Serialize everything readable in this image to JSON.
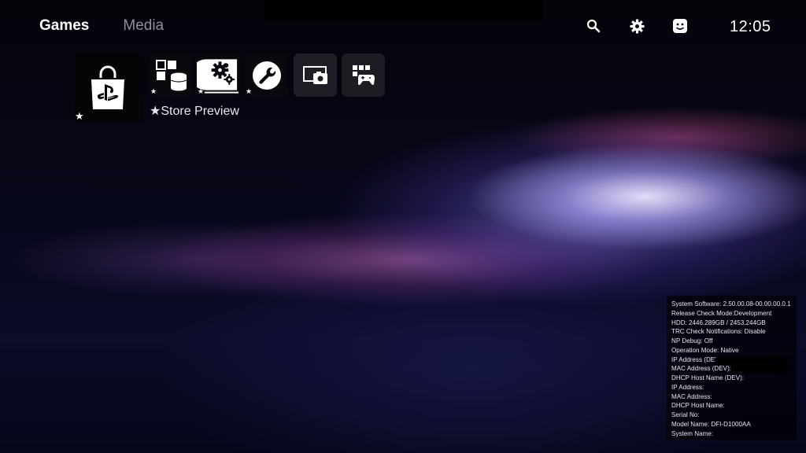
{
  "nav": {
    "tabs": [
      {
        "label": "Games",
        "active": true
      },
      {
        "label": "Media",
        "active": false
      }
    ]
  },
  "topbar": {
    "icons": [
      "search-icon",
      "gear-icon",
      "profile-face-icon"
    ],
    "clock": "12:05"
  },
  "tiles": [
    {
      "name": "playstation-store",
      "icon": "store-bag-icon",
      "starred": true
    },
    {
      "name": "store-preview",
      "icon": "blocks-database-icon",
      "starred": true
    },
    {
      "name": "settings-gears",
      "icon": "gears-icon",
      "starred": true
    },
    {
      "name": "debug-settings",
      "icon": "wrench-icon",
      "starred": true
    },
    {
      "name": "remote-play",
      "icon": "screen-camera-icon",
      "starred": false
    },
    {
      "name": "game-library",
      "icon": "grid-controller-icon",
      "starred": false
    }
  ],
  "focused_label": "★Store Preview",
  "star_glyph": "★",
  "colors": {
    "text": "#ffffff",
    "inactive_tab": "#8f8f99",
    "background": "#05050d"
  },
  "system_info": {
    "lines": [
      "System Software: 2.50.00.08-00.00.00.0.1",
      "Release Check Mode:Development",
      "HDD: 2446.289GB / 2453.244GB",
      "TRC Check Notifications: Disable",
      "NP Debug: Off",
      "Operation Mode: Native",
      "IP Address (DEV):",
      "MAC Address (DEV):",
      "DHCP Host Name (DEV):",
      "IP Address:",
      "MAC Address:",
      "DHCP Host Name:",
      "Serial No:",
      "Model Name: DFI-D1000AA",
      "System Name:"
    ]
  }
}
